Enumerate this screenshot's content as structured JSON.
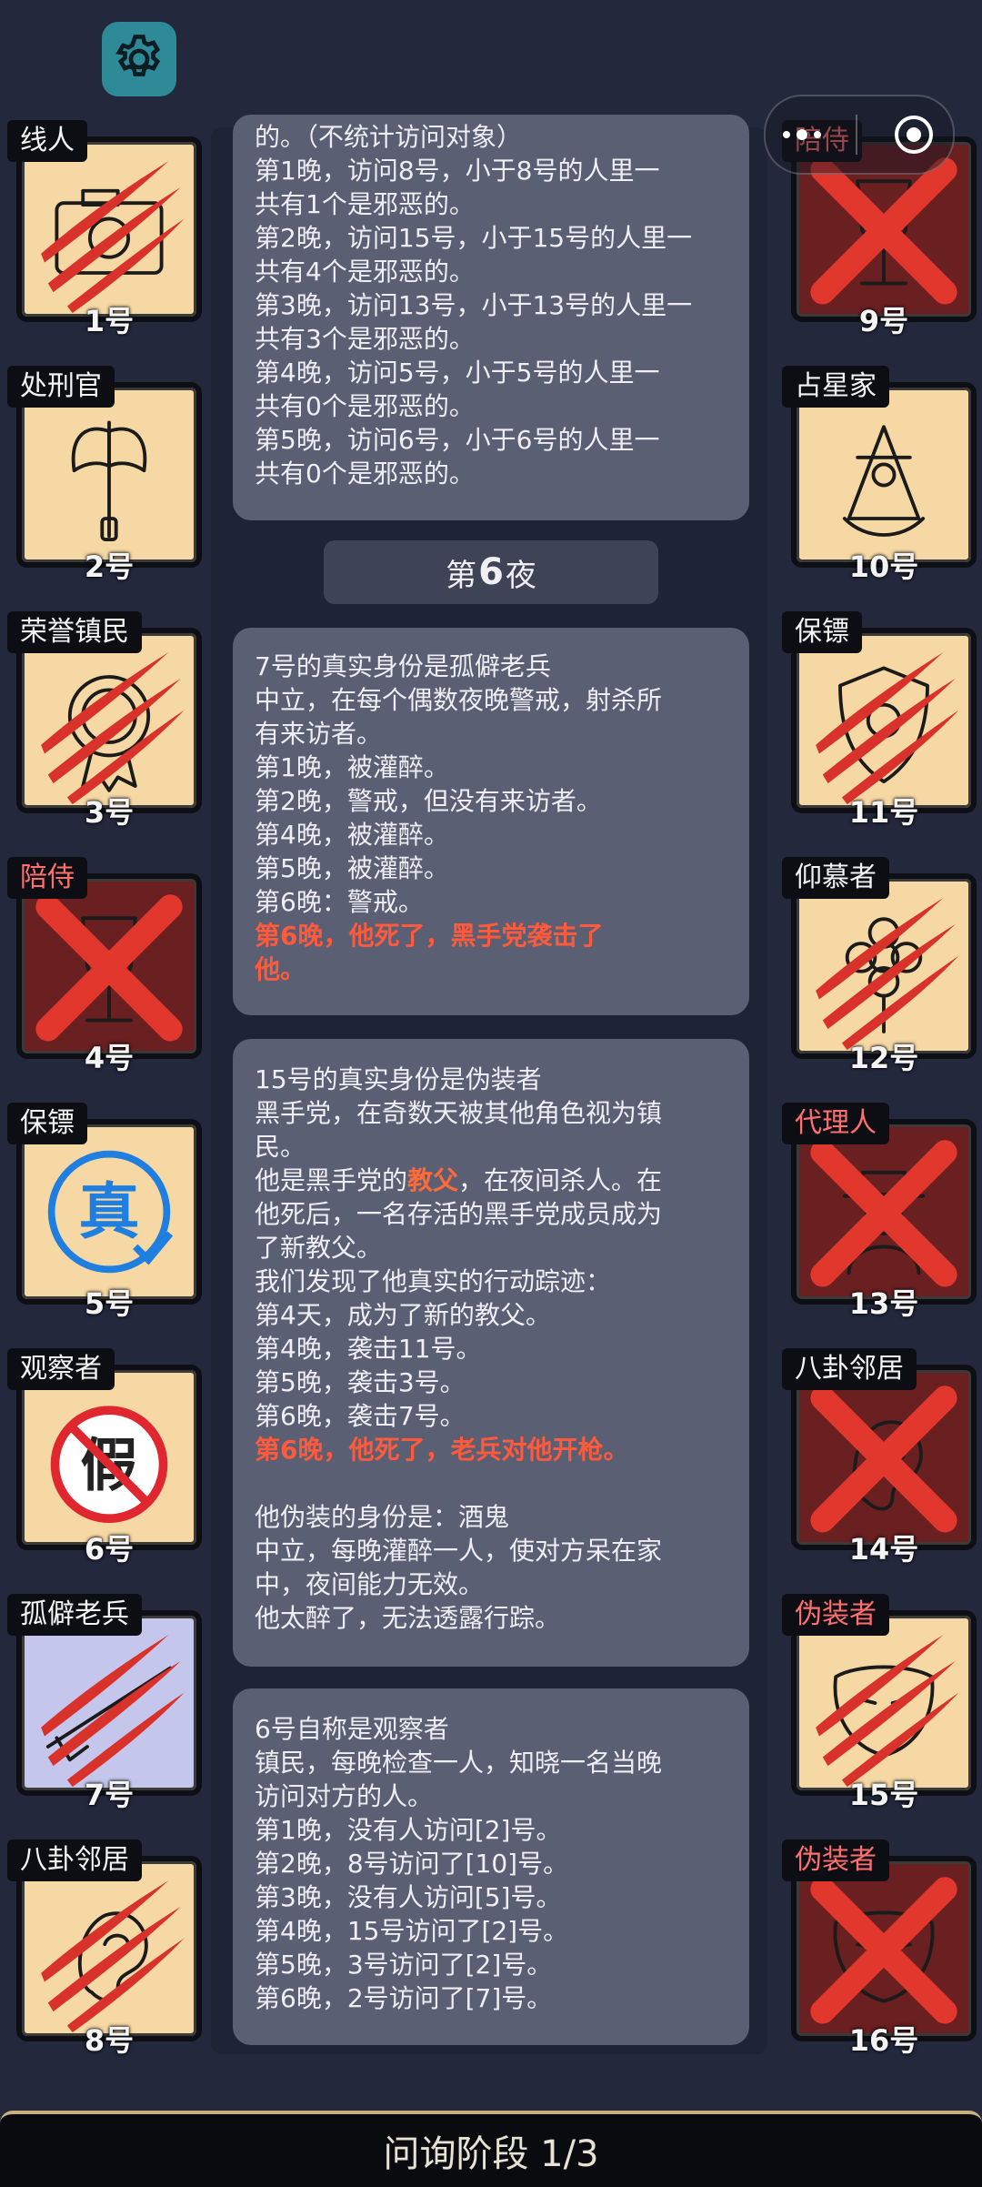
{
  "topbar": {
    "settings_icon": "gear-icon",
    "menu_icon": "more-dots-icon",
    "close_icon": "target-circle-icon"
  },
  "night_header": {
    "prefix": "第",
    "number": "6",
    "suffix": "夜"
  },
  "panels": [
    {
      "lines": [
        {
          "text": "的。（不统计访问对象）"
        },
        {
          "text": "第1晚，访问8号，小于8号的人里一"
        },
        {
          "text": "共有1个是邪恶的。"
        },
        {
          "text": "第2晚，访问15号，小于15号的人里一"
        },
        {
          "text": "共有4个是邪恶的。"
        },
        {
          "text": "第3晚，访问13号，小于13号的人里一"
        },
        {
          "text": "共有3个是邪恶的。"
        },
        {
          "text": "第4晚，访问5号，小于5号的人里一"
        },
        {
          "text": "共有0个是邪恶的。"
        },
        {
          "text": "第5晚，访问6号，小于6号的人里一"
        },
        {
          "text": "共有0个是邪恶的。"
        }
      ]
    },
    {
      "lines": [
        {
          "text": "7号的真实身份是孤僻老兵"
        },
        {
          "text": "中立，在每个偶数夜晚警戒，射杀所"
        },
        {
          "text": "有来访者。"
        },
        {
          "text": "第1晚，被灌醉。"
        },
        {
          "text": "第2晚，警戒，但没有来访者。"
        },
        {
          "text": "第4晚，被灌醉。"
        },
        {
          "text": "第5晚，被灌醉。"
        },
        {
          "text": "第6晚：警戒。"
        },
        {
          "text": "第6晚，他死了，黑手党袭击了",
          "style": "red"
        },
        {
          "text": "他。",
          "style": "red"
        }
      ]
    },
    {
      "lines": [
        {
          "text": "15号的真实身份是伪装者"
        },
        {
          "text": "黑手党，在奇数天被其他角色视为镇"
        },
        {
          "text": "民。"
        },
        {
          "text": "他是黑手党的",
          "highlight": "教父",
          "rest": "，在夜间杀人。在"
        },
        {
          "text": "他死后，一名存活的黑手党成员成为"
        },
        {
          "text": "了新教父。"
        },
        {
          "text": "我们发现了他真实的行动踪迹："
        },
        {
          "text": "第4天，成为了新的教父。"
        },
        {
          "text": "第4晚，袭击11号。"
        },
        {
          "text": "第5晚，袭击3号。"
        },
        {
          "text": "第6晚，袭击7号。"
        },
        {
          "text": "第6晚，他死了，老兵对他开枪。",
          "style": "red"
        },
        {
          "text": " "
        },
        {
          "text": "他伪装的身份是：酒鬼"
        },
        {
          "text": "中立，每晚灌醉一人，使对方呆在家"
        },
        {
          "text": "中，夜间能力无效。"
        },
        {
          "text": "他太醉了，无法透露行踪。"
        }
      ]
    },
    {
      "lines": [
        {
          "text": "6号自称是观察者"
        },
        {
          "text": "镇民，每晚检查一人，知晓一名当晚"
        },
        {
          "text": "访问对方的人。"
        },
        {
          "text": "第1晚，没有人访问[2]号。"
        },
        {
          "text": "第2晚，8号访问了[10]号。"
        },
        {
          "text": "第3晚，没有人访问[5]号。"
        },
        {
          "text": "第4晚，15号访问了[2]号。"
        },
        {
          "text": "第5晚，3号访问了[2]号。"
        },
        {
          "text": "第6晚，2号访问了[7]号。"
        }
      ]
    }
  ],
  "players_left": [
    {
      "role": "线人",
      "num": "1号",
      "icon": "camera-icon",
      "state": "slashed"
    },
    {
      "role": "处刑官",
      "num": "2号",
      "icon": "axe-icon",
      "state": "alive"
    },
    {
      "role": "荣誉镇民",
      "num": "3号",
      "icon": "medal-icon",
      "state": "slashed"
    },
    {
      "role": "陪侍",
      "num": "4号",
      "icon": "wine-glass-icon",
      "state": "crossed",
      "role_red": true
    },
    {
      "role": "保镖",
      "num": "5号",
      "icon": "true-stamp-icon",
      "state": "verified"
    },
    {
      "role": "观察者",
      "num": "6号",
      "icon": "fake-stamp-icon",
      "state": "fake"
    },
    {
      "role": "孤僻老兵",
      "num": "7号",
      "icon": "rifle-icon",
      "state": "slashed",
      "tile": "purple"
    },
    {
      "role": "八卦邻居",
      "num": "8号",
      "icon": "ear-icon",
      "state": "slashed"
    }
  ],
  "players_right": [
    {
      "role": "陪侍",
      "num": "9号",
      "icon": "wine-glass-icon",
      "state": "crossed",
      "role_red": true
    },
    {
      "role": "占星家",
      "num": "10号",
      "icon": "sextant-icon",
      "state": "alive"
    },
    {
      "role": "保镖",
      "num": "11号",
      "icon": "shield-icon",
      "state": "slashed"
    },
    {
      "role": "仰慕者",
      "num": "12号",
      "icon": "flower-icon",
      "state": "slashed"
    },
    {
      "role": "代理人",
      "num": "13号",
      "icon": "hat-man-icon",
      "state": "crossed",
      "role_red": true
    },
    {
      "role": "八卦邻居",
      "num": "14号",
      "icon": "ear-icon",
      "state": "crossed"
    },
    {
      "role": "伪装者",
      "num": "15号",
      "icon": "mask-icon",
      "state": "slashed",
      "role_red": true
    },
    {
      "role": "伪装者",
      "num": "16号",
      "icon": "mask-icon",
      "state": "crossed",
      "role_red": true
    }
  ],
  "footer": {
    "phase": "问询阶段 1/3"
  }
}
